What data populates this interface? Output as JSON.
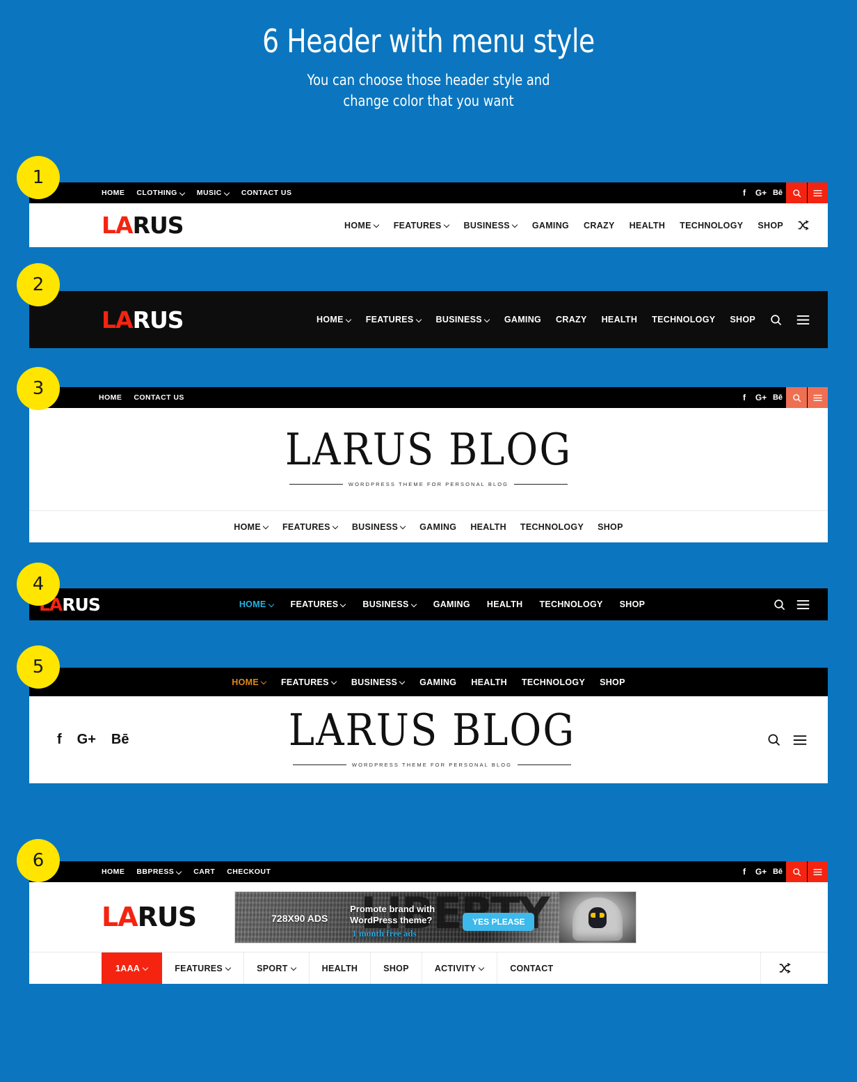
{
  "page": {
    "title": "6 Header with menu style",
    "subtitle_line1": "You can choose those header style and",
    "subtitle_line2": "change color that you want",
    "background_color": "#0b76bf",
    "badge_color": "#ffe500",
    "accent_red": "#f42410",
    "accent_coral": "#ef6f53",
    "accent_cyan": "#1fb6e8",
    "accent_orange": "#e08a17"
  },
  "social": {
    "facebook": "f",
    "googleplus": "G+",
    "behance": "Bē"
  },
  "logo": {
    "part1": "LA",
    "part2": "RUS"
  },
  "blog_logo": {
    "text": "LARUS BLOG",
    "tagline": "WORDPRESS THEME FOR PERSONAL BLOG"
  },
  "sections": [
    {
      "badge": "1",
      "topbar_links": [
        {
          "label": "HOME",
          "caret": false
        },
        {
          "label": "CLOTHING",
          "caret": true
        },
        {
          "label": "MUSIC",
          "caret": true
        },
        {
          "label": "CONTACT US",
          "caret": false
        }
      ],
      "nav": [
        {
          "label": "HOME",
          "caret": true
        },
        {
          "label": "FEATURES",
          "caret": true
        },
        {
          "label": "BUSINESS",
          "caret": true
        },
        {
          "label": "GAMING",
          "caret": false
        },
        {
          "label": "CRAZY",
          "caret": false
        },
        {
          "label": "HEALTH",
          "caret": false
        },
        {
          "label": "TECHNOLOGY",
          "caret": false
        },
        {
          "label": "SHOP",
          "caret": false
        }
      ]
    },
    {
      "badge": "2",
      "nav": [
        {
          "label": "HOME",
          "caret": true
        },
        {
          "label": "FEATURES",
          "caret": true
        },
        {
          "label": "BUSINESS",
          "caret": true
        },
        {
          "label": "GAMING",
          "caret": false
        },
        {
          "label": "CRAZY",
          "caret": false
        },
        {
          "label": "HEALTH",
          "caret": false
        },
        {
          "label": "TECHNOLOGY",
          "caret": false
        },
        {
          "label": "SHOP",
          "caret": false
        }
      ]
    },
    {
      "badge": "3",
      "topbar_links": [
        {
          "label": "HOME",
          "caret": false
        },
        {
          "label": "CONTACT US",
          "caret": false
        }
      ],
      "nav": [
        {
          "label": "HOME",
          "caret": true
        },
        {
          "label": "FEATURES",
          "caret": true
        },
        {
          "label": "BUSINESS",
          "caret": true
        },
        {
          "label": "GAMING",
          "caret": false
        },
        {
          "label": "HEALTH",
          "caret": false
        },
        {
          "label": "TECHNOLOGY",
          "caret": false
        },
        {
          "label": "SHOP",
          "caret": false
        }
      ]
    },
    {
      "badge": "4",
      "nav": [
        {
          "label": "HOME",
          "caret": true,
          "active": true
        },
        {
          "label": "FEATURES",
          "caret": true
        },
        {
          "label": "BUSINESS",
          "caret": true
        },
        {
          "label": "GAMING",
          "caret": false
        },
        {
          "label": "HEALTH",
          "caret": false
        },
        {
          "label": "TECHNOLOGY",
          "caret": false
        },
        {
          "label": "SHOP",
          "caret": false
        }
      ]
    },
    {
      "badge": "5",
      "nav": [
        {
          "label": "HOME",
          "caret": true,
          "active": true
        },
        {
          "label": "FEATURES",
          "caret": true
        },
        {
          "label": "BUSINESS",
          "caret": true
        },
        {
          "label": "GAMING",
          "caret": false
        },
        {
          "label": "HEALTH",
          "caret": false
        },
        {
          "label": "TECHNOLOGY",
          "caret": false
        },
        {
          "label": "SHOP",
          "caret": false
        }
      ]
    },
    {
      "badge": "6",
      "topbar_links": [
        {
          "label": "HOME",
          "caret": false
        },
        {
          "label": "BBPRESS",
          "caret": true
        },
        {
          "label": "CART",
          "caret": false
        },
        {
          "label": "CHECKOUT",
          "caret": false
        }
      ],
      "nav": [
        {
          "label": "1AAA",
          "caret": true,
          "active": true
        },
        {
          "label": "FEATURES",
          "caret": true
        },
        {
          "label": "SPORT",
          "caret": true
        },
        {
          "label": "HEALTH",
          "caret": false
        },
        {
          "label": "SHOP",
          "caret": false
        },
        {
          "label": "ACTIVITY",
          "caret": true
        },
        {
          "label": "CONTACT",
          "caret": false
        }
      ],
      "ad": {
        "size_label": "728X90 ADS",
        "headline_line1": "Promote brand with",
        "headline_line2": "WordPress theme?",
        "subline": "1 month free ads",
        "button": "YES PLEASE",
        "bg_word": "LIBERTY",
        "button_color": "#3db9ec"
      }
    }
  ],
  "icons": {
    "search": "search-icon",
    "hamburger": "hamburger-icon",
    "shuffle": "shuffle-icon"
  }
}
